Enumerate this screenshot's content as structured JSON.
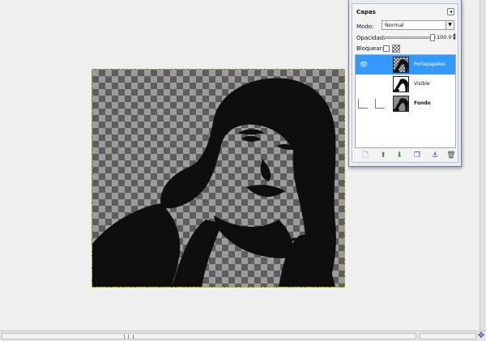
{
  "layers_panel": {
    "title": "Capas",
    "mode_label": "Modo:",
    "mode_value": "Normal",
    "opacity_label": "Opacidad:",
    "opacity_value": "100.0",
    "lock_label": "Bloquear:",
    "layers": [
      {
        "name": "Portapapeles",
        "selected": true,
        "visible": true,
        "bold": false
      },
      {
        "name": "Visible",
        "selected": false,
        "visible": false,
        "bold": false
      },
      {
        "name": "Fondo",
        "selected": false,
        "visible": false,
        "bold": true
      }
    ]
  },
  "colors": {
    "selection": "#3399ff",
    "selection_border": "#b9b400",
    "checker_dark": "#5d5d5d",
    "checker_light": "#9c9c9c"
  },
  "icons": {
    "new_layer": "new-layer-icon",
    "raise": "raise-layer-icon",
    "lower": "lower-layer-icon",
    "duplicate": "duplicate-layer-icon",
    "anchor": "anchor-layer-icon",
    "delete": "delete-layer-icon"
  }
}
